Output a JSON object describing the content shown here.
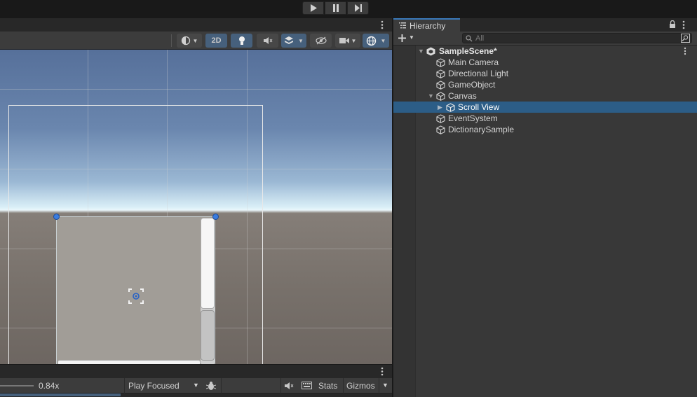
{
  "playbar": {
    "play_icon": "play-icon",
    "pause_icon": "pause-icon",
    "step_icon": "step-icon"
  },
  "scene_toolbar": {
    "mode_2d": "2D",
    "icons": [
      "shading-mode-icon",
      "lighting-icon",
      "audio-mute-icon",
      "effects-icon",
      "visibility-icon",
      "camera-icon",
      "gizmos-globe-icon"
    ]
  },
  "game_toolbar": {
    "scale_value": "0.84x",
    "play_mode": "Play Focused",
    "stats_label": "Stats",
    "gizmos_label": "Gizmos"
  },
  "hierarchy": {
    "tab_label": "Hierarchy",
    "search_placeholder": "All",
    "scene_name": "SampleScene*",
    "items": [
      {
        "label": "Main Camera"
      },
      {
        "label": "Directional Light"
      },
      {
        "label": "GameObject"
      },
      {
        "label": "Canvas"
      },
      {
        "label": "Scroll View",
        "selected": true
      },
      {
        "label": "EventSystem"
      },
      {
        "label": "DictionarySample"
      }
    ]
  },
  "colors": {
    "selection": "#2c5d87",
    "accent_blue": "#46607c"
  }
}
